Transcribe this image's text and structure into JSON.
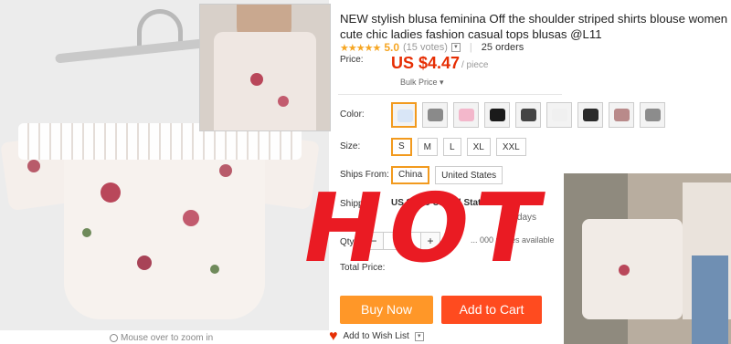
{
  "product": {
    "title": "NEW stylish blusa feminina Off the shoulder striped shirts blouse women cute chic ladies fashion casual tops blusas @L11",
    "stars": "★★★★★",
    "score": "5.0",
    "votes": "(15 votes)",
    "orders": "25 orders"
  },
  "price": {
    "label": "Price:",
    "value": "US $4.47",
    "unit": "/ piece",
    "bulk": "Bulk Price ▾"
  },
  "color": {
    "label": "Color:",
    "swatches": [
      "#d9e6f7",
      "#8a8a8a",
      "#f3b7cb",
      "#1a1a1a",
      "#444444",
      "#f0f0f0",
      "#2a2a2a",
      "#b98a8a",
      "#8c8c8c"
    ]
  },
  "size": {
    "label": "Size:",
    "options": [
      "S",
      "M",
      "L",
      "XL",
      "XXL"
    ]
  },
  "ships": {
    "label": "Ships From:",
    "options": [
      "China",
      "United States"
    ]
  },
  "shipping": {
    "label": "Shipping:",
    "value": "US $... to United States via Packet",
    "days": "20 days"
  },
  "quantity": {
    "label": "Qty:",
    "value": "1",
    "minus": "−",
    "plus": "+",
    "available": "... 000 pieces available"
  },
  "total": {
    "label": "Total Price:"
  },
  "buttons": {
    "buy": "Buy Now",
    "cart": "Add to Cart",
    "wishlist": "Add to Wish List"
  },
  "zoom_hint": "Mouse over to zoom in",
  "overlay": "HOT",
  "colors": {
    "accent": "#e62e04",
    "buy": "#ff9728",
    "cart": "#ff4b1f",
    "selected": "#f29a1e"
  }
}
